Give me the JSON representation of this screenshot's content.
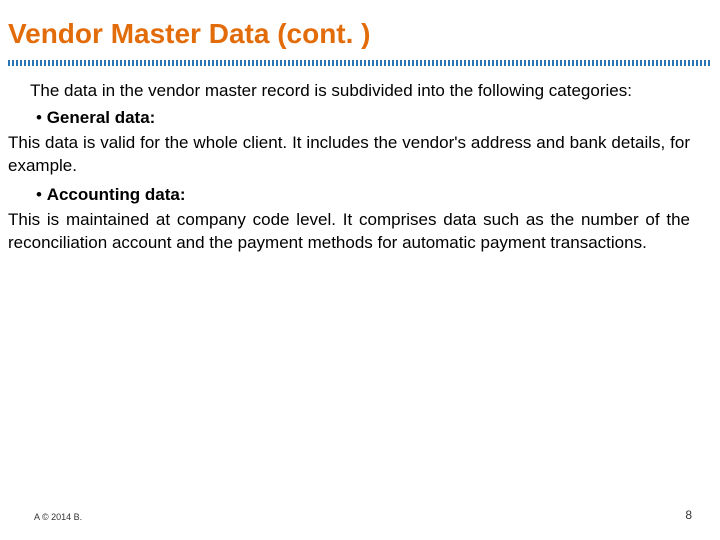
{
  "title": "Vendor Master Data (cont. )",
  "intro": "The data in the vendor master record is subdivided into the following categories:",
  "sections": [
    {
      "heading": "General data:",
      "body": "This data is valid for the whole client. It includes the vendor's address and bank details, for example."
    },
    {
      "heading": "Accounting data:",
      "body": "This is maintained at company code level. It comprises data such as the number of the reconciliation account and the payment methods for automatic payment transactions."
    }
  ],
  "footer": {
    "left": "A © 2014 B.",
    "page": "8"
  }
}
